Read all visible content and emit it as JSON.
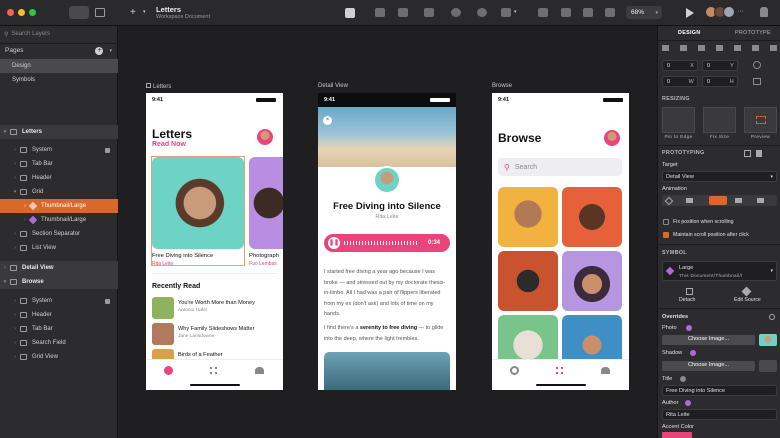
{
  "toolbar": {
    "doc_title": "Letters",
    "doc_subtitle": "Workspace Document",
    "zoom": "68%"
  },
  "sidebar": {
    "search_placeholder": "Search Layers",
    "pages_label": "Pages",
    "pages": [
      "Design",
      "Symbols"
    ],
    "letters": [
      "Letters",
      "System",
      "Tab Bar",
      "Header",
      "Grid",
      "Thumbnail/Large",
      "Thumbnail/Large",
      "Section Separator",
      "List View"
    ],
    "detail": "Detail View",
    "browse": [
      "Browse",
      "System",
      "Header",
      "Tab Bar",
      "Search Field",
      "Grid View"
    ]
  },
  "artboards": {
    "letters": {
      "label": "Letters",
      "time": "9:41",
      "title": "Letters",
      "subtitle": "Read Now",
      "card1_title": "Free Diving into Silence",
      "card1_author": "Rita Leite",
      "card2_title": "Photograph",
      "card2_author": "Fuo Lembas",
      "recent": "Recently Read",
      "items": [
        {
          "title": "You're Worth More than Money",
          "author": "Antonio Hafer"
        },
        {
          "title": "Why Family Slideshows Matter",
          "author": "Jane Lansdowne"
        },
        {
          "title": "Birds of a Feather",
          "author": ""
        }
      ]
    },
    "detail": {
      "label": "Detail View",
      "time": "9:41",
      "title": "Free Diving into Silence",
      "author": "Rita Leite",
      "audio_time": "0:34",
      "p1": "I started free diving a year ago because I was broke — and stressed out by my doctorate thesis-in-limbo. All I had was a pair of flippers liberated from my ex (don't ask) and lots of time on my hands.",
      "p2a": "I find there's a ",
      "p2b": "serenity to free diving",
      "p2c": " — to glide into the deep, where the light trembles."
    },
    "browse": {
      "label": "Browse",
      "time": "9:41",
      "title": "Browse",
      "search": "Search"
    }
  },
  "inspector": {
    "tabs": [
      "DESIGN",
      "PROTOTYPE"
    ],
    "coords": {
      "x": "0",
      "y": "0",
      "w": "0",
      "h": "0"
    },
    "resizing": "RESIZING",
    "resize_opts": [
      "Pin to Edge",
      "Fix Size",
      "Preview"
    ],
    "prototyping": "PROTOTYPING",
    "target_label": "Target",
    "target": "Detail View",
    "animation": "Animation",
    "fix_scroll": "Fix position when scrolling",
    "maintain_scroll": "Maintain scroll position after click",
    "symbol": "SYMBOL",
    "symbol_name": "Large",
    "symbol_path": "This Document/Thumbnail/l",
    "detach": "Detach",
    "edit_source": "Edit Source",
    "overrides": "Overrides",
    "photo": "Photo",
    "shadow": "Shadow",
    "choose": "Choose Image...",
    "title_label": "Title",
    "title_value": "Free Diving into Silence",
    "author_label": "Author",
    "author_value": "Rita Leite",
    "accent": "Accent Color"
  },
  "colors": {
    "accent": "#d9692b",
    "pink": "#e9457a"
  }
}
